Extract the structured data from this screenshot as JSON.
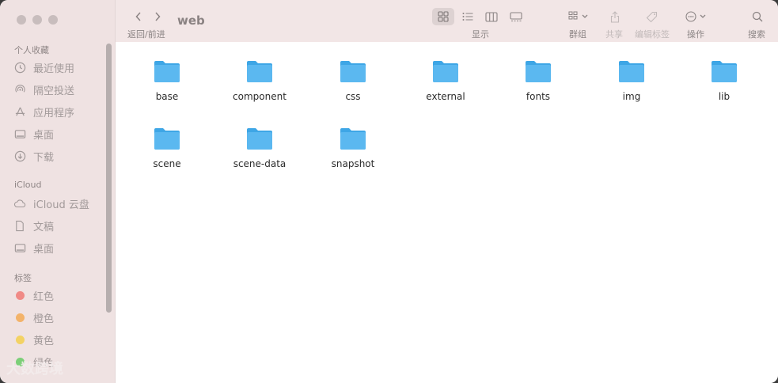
{
  "toolbar": {
    "title": "web",
    "nav_label": "返回/前进",
    "display_label": "显示",
    "group_label": "群组",
    "share_label": "共享",
    "edit_tags_label": "编辑标签",
    "action_label": "操作",
    "search_label": "搜索"
  },
  "sidebar": {
    "favorites_header": "个人收藏",
    "favorites": [
      {
        "label": "最近使用",
        "icon": "clock-icon"
      },
      {
        "label": "隔空投送",
        "icon": "airdrop-icon"
      },
      {
        "label": "应用程序",
        "icon": "applications-icon"
      },
      {
        "label": "桌面",
        "icon": "desktop-icon"
      },
      {
        "label": "下载",
        "icon": "download-icon"
      }
    ],
    "icloud_header": "iCloud",
    "icloud": [
      {
        "label": "iCloud 云盘",
        "icon": "cloud-icon"
      },
      {
        "label": "文稿",
        "icon": "document-icon"
      },
      {
        "label": "桌面",
        "icon": "desktop-icon"
      }
    ],
    "tags_header": "标签",
    "tags": [
      {
        "label": "红色",
        "color": "#f08a86"
      },
      {
        "label": "橙色",
        "color": "#f3b36a"
      },
      {
        "label": "黄色",
        "color": "#f3d264"
      },
      {
        "label": "绿色",
        "color": "#7ccf78"
      }
    ]
  },
  "folders": [
    {
      "name": "base"
    },
    {
      "name": "component"
    },
    {
      "name": "css"
    },
    {
      "name": "external"
    },
    {
      "name": "fonts"
    },
    {
      "name": "img"
    },
    {
      "name": "lib"
    },
    {
      "name": "scene"
    },
    {
      "name": "scene-data"
    },
    {
      "name": "snapshot"
    }
  ],
  "watermark": "大数跨境",
  "colors": {
    "sidebar_bg": "#efe2e2",
    "toolbar_bg": "#f2e6e6",
    "folder_blue": "#5bb8f0"
  }
}
